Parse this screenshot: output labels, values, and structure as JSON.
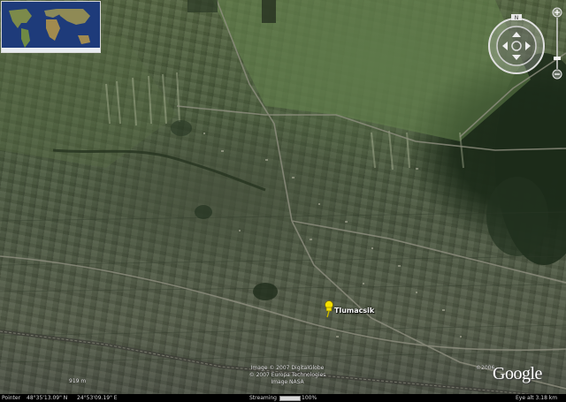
{
  "map": {
    "place_label": "Tlumacsik",
    "credits": [
      "Image © 2007 DigitalGlobe",
      "© 2007 Europa Technologies",
      "Image NASA"
    ],
    "copyright_year": "©2006",
    "logo": "Google",
    "scale_text": "919 m"
  },
  "status_bar": {
    "pointer_label": "Pointer",
    "latitude": "48°35'13.09\" N",
    "longitude": "24°53'09.19\" E",
    "streaming_label": "Streaming",
    "streaming_percent": "100%",
    "streaming_progress": 1.0,
    "eye_alt": "Eye alt    3.18 km"
  },
  "colors": {
    "placemark": "#f5e000",
    "status_bar_bg": "#000000"
  },
  "icons": {
    "placemark": "yellow-pushpin-icon",
    "navigation": "compass-ring-icon",
    "look_up": "chevron-up-icon",
    "look_down": "chevron-down-icon",
    "look_left": "chevron-left-icon",
    "look_right": "chevron-right-icon",
    "north": "north-marker-icon",
    "zoom_in": "plus-icon",
    "zoom_out": "minus-icon"
  }
}
